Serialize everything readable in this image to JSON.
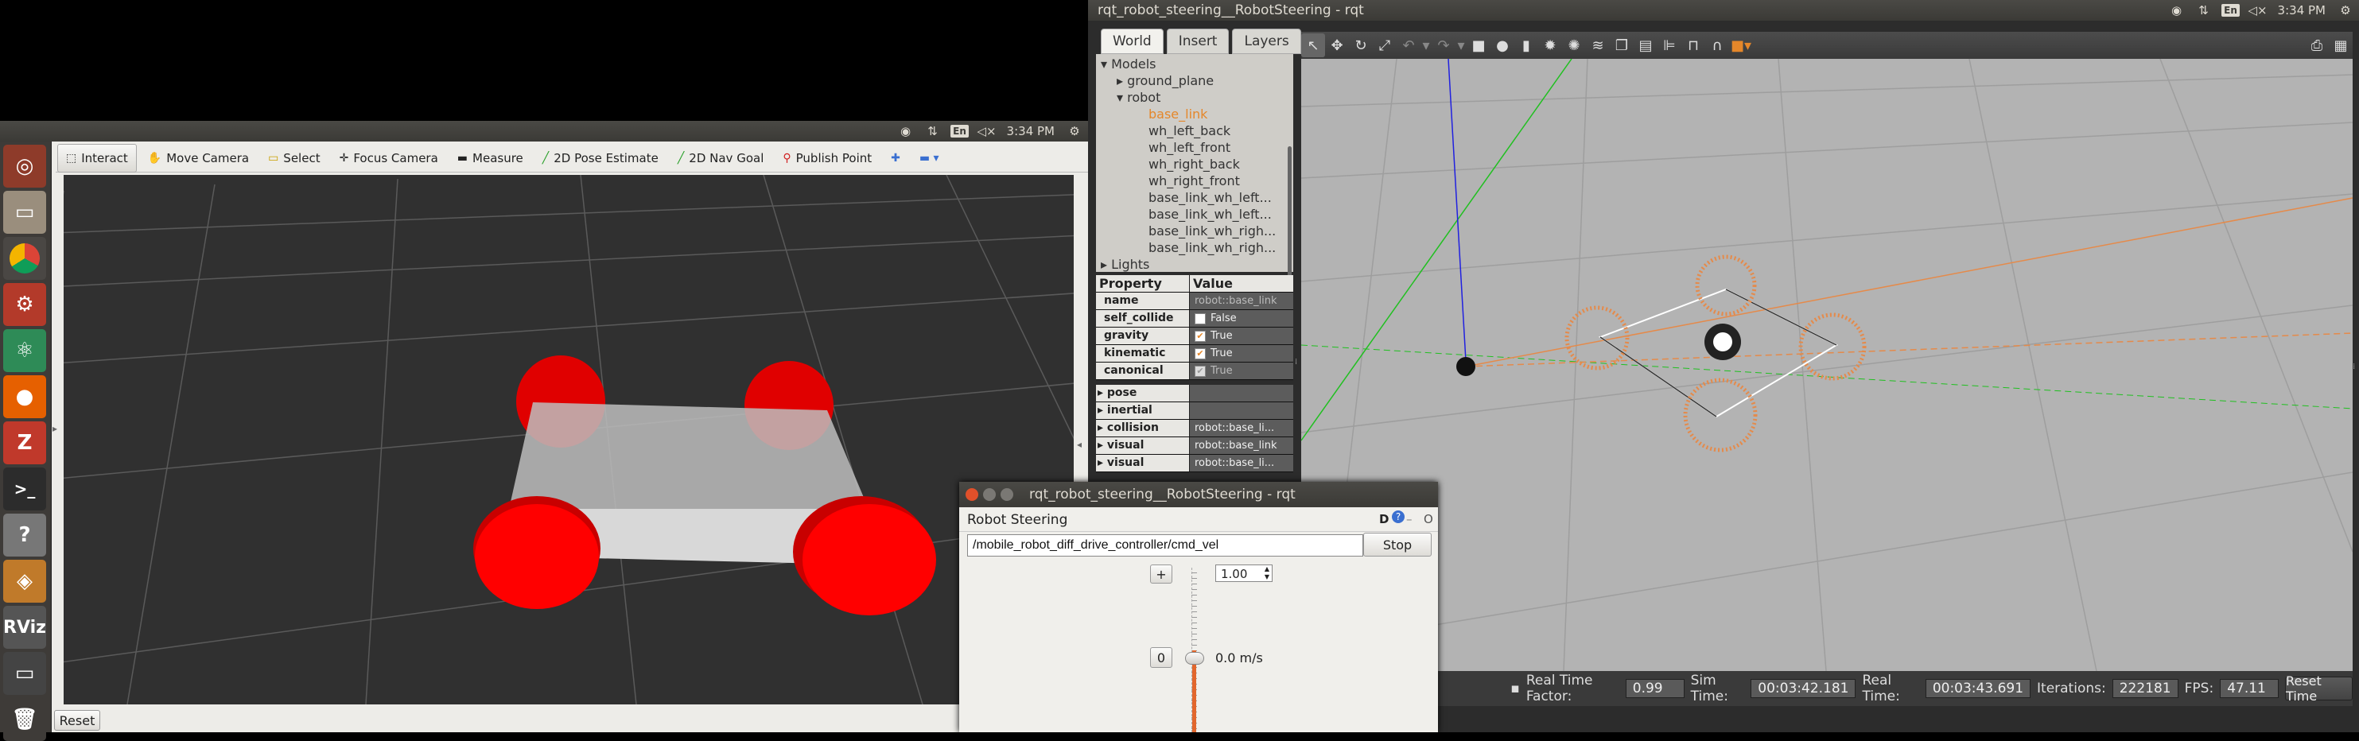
{
  "top_bar": {
    "time": "3:34 PM",
    "lang": "En"
  },
  "rviz": {
    "tools": [
      {
        "icon": "cursor-icon",
        "label": "Interact"
      },
      {
        "icon": "move-camera-icon",
        "label": "Move Camera"
      },
      {
        "icon": "select-icon",
        "label": "Select"
      },
      {
        "icon": "focus-camera-icon",
        "label": "Focus Camera"
      },
      {
        "icon": "measure-icon",
        "label": "Measure"
      },
      {
        "icon": "pose-estimate-icon",
        "label": "2D Pose Estimate"
      },
      {
        "icon": "nav-goal-icon",
        "label": "2D Nav Goal"
      },
      {
        "icon": "publish-point-icon",
        "label": "Publish Point"
      }
    ],
    "reset_label": "Reset"
  },
  "gazebo": {
    "window_title": "rqt_robot_steering__RobotSteering - rqt",
    "tabs": [
      "World",
      "Insert",
      "Layers"
    ],
    "tree": {
      "models_label": "Models",
      "ground_plane": "ground_plane",
      "robot": "robot",
      "links": [
        "base_link",
        "wh_left_back",
        "wh_left_front",
        "wh_right_back",
        "wh_right_front",
        "base_link_wh_left...",
        "base_link_wh_left...",
        "base_link_wh_righ...",
        "base_link_wh_righ..."
      ],
      "lights_label": "Lights"
    },
    "properties": {
      "header": {
        "property": "Property",
        "value": "Value"
      },
      "rows": [
        {
          "name": "name",
          "value": "robot::base_link"
        },
        {
          "name": "self_collide",
          "value": "False"
        },
        {
          "name": "gravity",
          "value": "True"
        },
        {
          "name": "kinematic",
          "value": "True"
        },
        {
          "name": "canonical",
          "value": "True"
        }
      ],
      "groups": [
        {
          "name": "pose",
          "value": ""
        },
        {
          "name": "inertial",
          "value": ""
        },
        {
          "name": "collision",
          "value": "robot::base_li..."
        },
        {
          "name": "visual",
          "value": "robot::base_link"
        },
        {
          "name": "visual",
          "value": "robot::base_li..."
        }
      ]
    },
    "status": {
      "rtf_label": "Real Time Factor:",
      "rtf": "0.99",
      "sim_label": "Sim Time:",
      "sim": "00:03:42.181",
      "real_label": "Real Time:",
      "real": "00:03:43.691",
      "iter_label": "Iterations:",
      "iter": "222181",
      "fps_label": "FPS:",
      "fps": "47.11",
      "reset_label": "Reset Time"
    }
  },
  "rqt": {
    "title": "rqt_robot_steering__RobotSteering - rqt",
    "plugin_name": "Robot Steering",
    "plugin_icons": "D",
    "topic": "/mobile_robot_diff_drive_controller/cmd_vel",
    "stop_label": "Stop",
    "plus_label": "+",
    "max_value": "1.00",
    "zero_label": "0",
    "velocity": "0.0 m/s"
  },
  "colors": {
    "gazebo_accent": "#e5872a",
    "wheel_red": "#ff0000",
    "ubuntu_orange": "#dd4814"
  }
}
